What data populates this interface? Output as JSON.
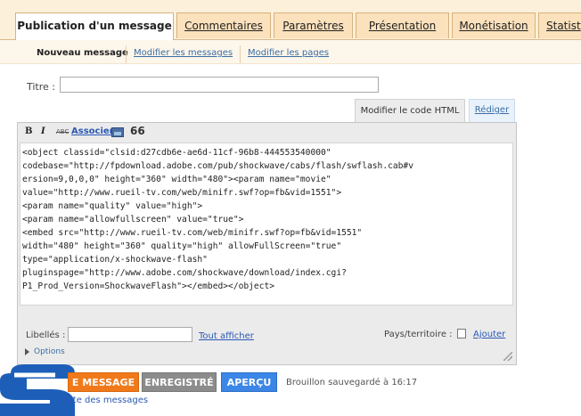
{
  "tabs": {
    "publication": "Publication d'un message",
    "comments": "Commentaires",
    "settings": "Paramètres",
    "presentation": "Présentation",
    "monetization": "Monétisation",
    "stats": "Statist"
  },
  "subtabs": {
    "new_message": "Nouveau message",
    "edit_messages": "Modifier les messages",
    "edit_pages": "Modifier les pages"
  },
  "title_field": {
    "label": "Titre :",
    "value": ""
  },
  "editor_modes": {
    "html": "Modifier le code HTML",
    "compose": "Rédiger"
  },
  "toolbar": {
    "bold": "B",
    "italic": "I",
    "strike": "ABC",
    "link": "Associer",
    "quote": "66"
  },
  "code_lines": [
    "<object classid=\"clsid:d27cdb6e-ae6d-11cf-96b8-444553540000\"",
    "codebase=\"http://fpdownload.adobe.com/pub/shockwave/cabs/flash/swflash.cab#v",
    "ersion=9,0,0,0\" height=\"360\" width=\"480\"><param name=\"movie\"",
    "value=\"http://www.rueil-tv.com/web/minifr.swf?op=fb&vid=1551\">",
    "<param name=\"quality\" value=\"high\">",
    "<param name=\"allowfullscreen\" value=\"true\">",
    "<embed src=\"http://www.rueil-tv.com/web/minifr.swf?op=fb&vid=1551\"",
    "width=\"480\" height=\"360\" quality=\"high\" allowFullScreen=\"true\"",
    "type=\"application/x-shockwave-flash\"",
    "pluginspage=\"http://www.adobe.com/shockwave/download/index.cgi?",
    "P1_Prod_Version=ShockwaveFlash\"></embed></object>"
  ],
  "labels": {
    "label": "Libellés :",
    "value": "",
    "show_all": "Tout afficher"
  },
  "location": {
    "label": "Pays/territoire :",
    "add": "Ajouter"
  },
  "options": "Options",
  "buttons": {
    "publish": "E MESSAGE",
    "saved": "ENREGISTRÉ",
    "preview": "APERÇU"
  },
  "draft_status": "Brouillon sauvegardé à 16:17",
  "return_link": "liste des messages"
}
